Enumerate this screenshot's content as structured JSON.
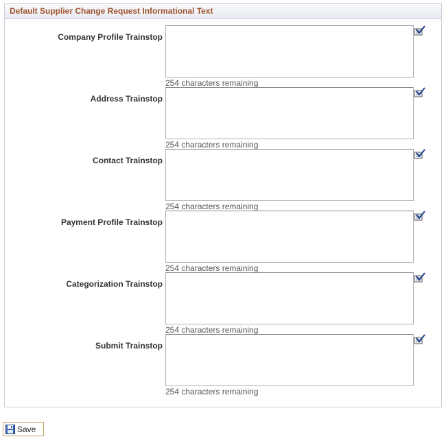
{
  "group": {
    "title": "Default Supplier Change Request Informational Text"
  },
  "fields": [
    {
      "label": "Company Profile Trainstop",
      "value": "",
      "counter": "254 characters remaining",
      "icon": "spell-check-icon"
    },
    {
      "label": "Address Trainstop",
      "value": "",
      "counter": "254 characters remaining",
      "icon": "spell-check-icon"
    },
    {
      "label": "Contact Trainstop",
      "value": "",
      "counter": "254 characters remaining",
      "icon": "spell-check-icon"
    },
    {
      "label": "Payment Profile Trainstop",
      "value": "",
      "counter": "254 characters remaining",
      "icon": "spell-check-icon"
    },
    {
      "label": "Categorization Trainstop",
      "value": "",
      "counter": "254 characters remaining",
      "icon": "spell-check-icon"
    },
    {
      "label": "Submit Trainstop",
      "value": "",
      "counter": "254 characters remaining",
      "icon": "spell-check-icon"
    }
  ],
  "toolbar": {
    "save_label": "Save",
    "save_icon": "floppy-disk-icon"
  },
  "colors": {
    "header_text": "#a0522d",
    "border": "#c8cfd8",
    "save_border": "#c0a060"
  }
}
